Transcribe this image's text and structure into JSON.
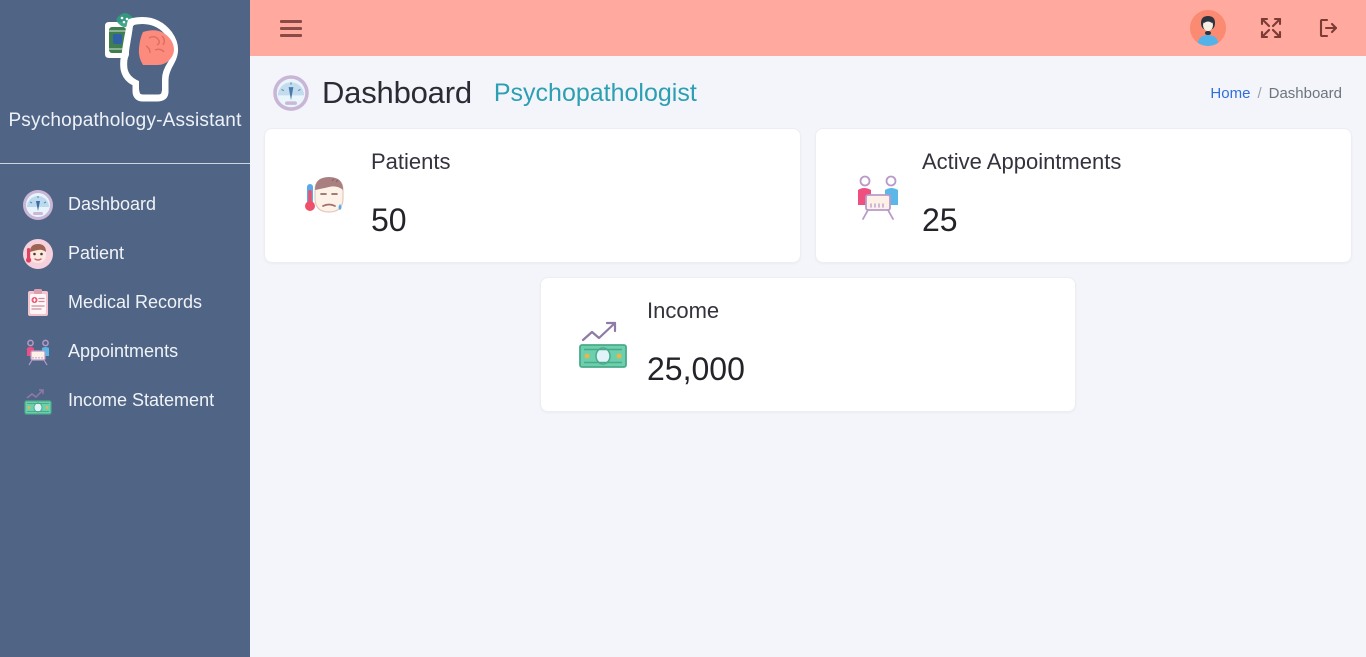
{
  "sidebar": {
    "brand_name": "Psychopathology-Assistant",
    "brand_logo_icon": "brain-head-ai-icon",
    "items": [
      {
        "label": "Dashboard",
        "icon": "speedometer-gauge-icon"
      },
      {
        "label": "Patient",
        "icon": "patient-face-icon"
      },
      {
        "label": "Medical Records",
        "icon": "clipboard-medical-icon"
      },
      {
        "label": "Appointments",
        "icon": "meeting-table-icon"
      },
      {
        "label": "Income Statement",
        "icon": "banknote-chart-icon"
      }
    ]
  },
  "topbar": {
    "menu_toggle_icon": "hamburger-icon",
    "avatar_icon": "user-avatar-icon",
    "fullscreen_icon": "expand-arrows-icon",
    "logout_icon": "logout-icon",
    "background_color": "#ffa99f"
  },
  "page": {
    "icon": "speedometer-gauge-icon",
    "title": "Dashboard",
    "subtitle": "Psychopathologist",
    "subtitle_color": "#2c9fb3",
    "breadcrumb": {
      "home": "Home",
      "separator": "/",
      "current": "Dashboard",
      "home_color": "#2f6fdd"
    }
  },
  "cards": [
    {
      "label": "Patients",
      "value": "50",
      "icon": "sick-patient-thermometer-icon"
    },
    {
      "label": "Active Appointments",
      "value": "25",
      "icon": "two-people-table-icon"
    },
    {
      "label": "Income",
      "value": "25,000",
      "icon": "money-growth-icon"
    }
  ]
}
